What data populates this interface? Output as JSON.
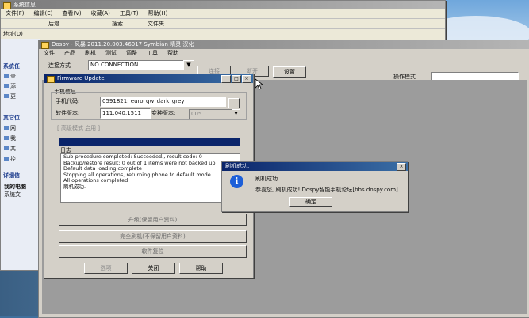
{
  "explorer": {
    "title": "系统信息",
    "menu": [
      "文件(F)",
      "编辑(E)",
      "查看(V)",
      "收藏(A)",
      "工具(T)",
      "帮助(H)"
    ],
    "toolbar": {
      "back": "后退",
      "search": "搜索",
      "folders": "文件夹"
    },
    "address_label": "地址(D)",
    "side": {
      "task_title": "系统任",
      "task_items": [
        "查",
        "添",
        "更"
      ],
      "other_title": "其它位",
      "other_items": [
        "网",
        "我",
        "共",
        "控"
      ],
      "detail_title": "详细信",
      "detail_items": [
        "我的电脑",
        "系统文"
      ]
    }
  },
  "dospy": {
    "title": "Dospy - 风暴 2011.20.003.46017 Symbian 精灵 汉化",
    "menu": [
      "文件",
      "产品",
      "刷机",
      "测试",
      "调整",
      "工具",
      "帮助"
    ],
    "connect_label": "连接方式",
    "connect_value": "NO CONNECTION",
    "connect_btn": "连接",
    "disconnect_btn": "断开",
    "settings_btn": "设置",
    "mode_label": "操作模式"
  },
  "firmware": {
    "title": "Firmware Update",
    "phone_info_label": "手机信息",
    "product_code_label": "手机代码:",
    "product_code_value": "0591821: euro_qw_dark_grey",
    "sw_version_label": "软件版本:",
    "sw_version_value": "111.040.1511",
    "variant_label": "变种版本:",
    "variant_value": "005",
    "advanced_label": "[ 高级模式 启用 ]",
    "log_label": "日志",
    "log_lines": [
      "Sub-procedure completed: Succeeded., result code: 0",
      "Backup/restore result: 0 out of 1 items were not backed up",
      "Default data loading complete",
      "Stopping all operations, returning phone to default mode",
      "All operations completed",
      "刷机成功."
    ],
    "progress": 1.0,
    "upgrade_keep_btn": "升级(保留用户资料)",
    "full_flash_btn": "完全刷机(不保留用户资料)",
    "software_reset_btn": "软件复位",
    "options_btn": "选项",
    "close_btn": "关闭",
    "help_btn": "帮助"
  },
  "dialog": {
    "title": "刷机成功.",
    "line1": "刷机成功.",
    "line2": "恭喜您, 刷机成功! Dospy智能手机论坛[bbs.dospy.com]",
    "ok": "确定"
  },
  "colors": {
    "title_active": "#0a246a",
    "window_face": "#d4d0c8",
    "progress_fill": "#0a246a"
  }
}
